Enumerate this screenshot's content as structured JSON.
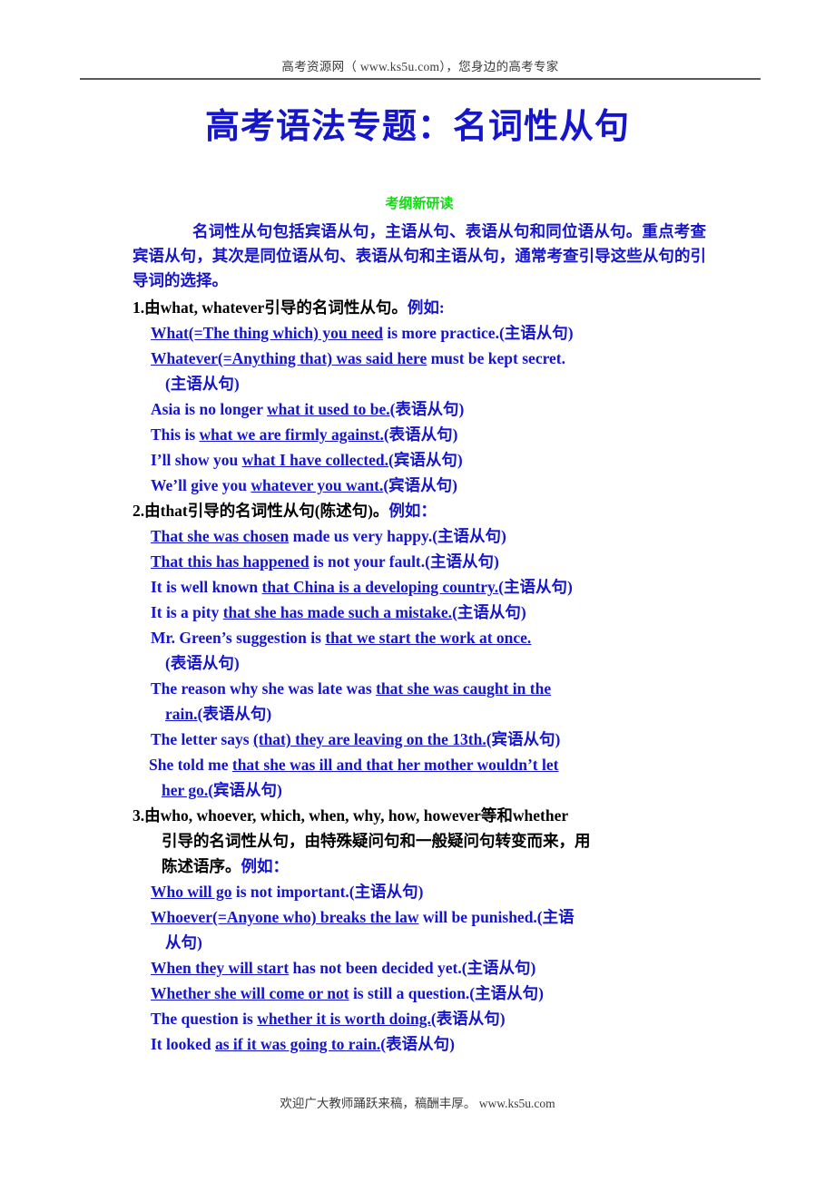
{
  "header": {
    "text": "高考资源网（ www.ks5u.com），您身边的高考专家"
  },
  "title": "高考语法专题：名词性从句",
  "section_heading": "考纲新研读",
  "intro": "名词性从句包括宾语从句，主语从句、表语从句和同位语从句。重点考查宾语从句，其次是同位语从句、表语从句和主语从句，通常考查引导这些从句的引导词的选择。",
  "rules": [
    {
      "number": "1.",
      "head_main": "由what, whatever引导的名词性从句。",
      "head_eg": "例如:",
      "examples": [
        {
          "lines": [
            {
              "parts": [
                {
                  "t": "What(=The thing which) you need",
                  "u": true
                },
                {
                  "t": " is more practice.(主语从句)",
                  "u": false
                }
              ]
            }
          ]
        },
        {
          "lines": [
            {
              "parts": [
                {
                  "t": "Whatever(=Anything that) was said here",
                  "u": true
                },
                {
                  "t": " must be kept secret.",
                  "u": false
                }
              ]
            },
            {
              "parts": [
                {
                  "t": "(主语从句)",
                  "u": false
                }
              ]
            }
          ]
        },
        {
          "lines": [
            {
              "parts": [
                {
                  "t": "Asia is no longer ",
                  "u": false
                },
                {
                  "t": "what it used to be.",
                  "u": true
                },
                {
                  "t": "(表语从句)",
                  "u": false
                }
              ]
            }
          ]
        },
        {
          "lines": [
            {
              "parts": [
                {
                  "t": "This is ",
                  "u": false
                },
                {
                  "t": "what we are firmly against.",
                  "u": true
                },
                {
                  "t": "(表语从句)",
                  "u": false
                }
              ]
            }
          ]
        },
        {
          "lines": [
            {
              "parts": [
                {
                  "t": "I’ll show you ",
                  "u": false
                },
                {
                  "t": "what I have collected.",
                  "u": true
                },
                {
                  "t": "(宾语从句)",
                  "u": false
                }
              ]
            }
          ]
        },
        {
          "lines": [
            {
              "parts": [
                {
                  "t": "We’ll give you ",
                  "u": false
                },
                {
                  "t": "whatever you want.",
                  "u": true
                },
                {
                  "t": "(宾语从句)",
                  "u": false
                }
              ]
            }
          ]
        }
      ]
    },
    {
      "number": "2.",
      "head_main": "由that引导的名词性从句(陈述句)。",
      "head_eg": "例如：",
      "examples": [
        {
          "lines": [
            {
              "parts": [
                {
                  "t": "That she was chosen",
                  "u": true
                },
                {
                  "t": " made us very happy.(主语从句)",
                  "u": false
                }
              ]
            }
          ]
        },
        {
          "lines": [
            {
              "parts": [
                {
                  "t": "That this has happened",
                  "u": true
                },
                {
                  "t": " is not your fault.(主语从句)",
                  "u": false
                }
              ]
            }
          ]
        },
        {
          "lines": [
            {
              "parts": [
                {
                  "t": "It is well known ",
                  "u": false
                },
                {
                  "t": "that China is a developing country.",
                  "u": true
                },
                {
                  "t": "(主语从句)",
                  "u": false
                }
              ]
            }
          ]
        },
        {
          "lines": [
            {
              "parts": [
                {
                  "t": "It is a pity ",
                  "u": false
                },
                {
                  "t": "that she has made such a mistake.",
                  "u": true
                },
                {
                  "t": "(主语从句)",
                  "u": false
                }
              ]
            }
          ]
        },
        {
          "lines": [
            {
              "parts": [
                {
                  "t": "Mr. Green’s suggestion is ",
                  "u": false
                },
                {
                  "t": "that we start the work at once.",
                  "u": true
                }
              ]
            },
            {
              "parts": [
                {
                  "t": "(表语从句)",
                  "u": false
                }
              ]
            }
          ]
        },
        {
          "lines": [
            {
              "parts": [
                {
                  "t": "The reason why she was late was ",
                  "u": false
                },
                {
                  "t": "that she was caught in the ",
                  "u": true
                }
              ]
            },
            {
              "parts": [
                {
                  "t": "rain.",
                  "u": true
                },
                {
                  "t": "(表语从句)",
                  "u": false
                }
              ]
            }
          ]
        },
        {
          "lines": [
            {
              "parts": [
                {
                  "t": "The letter says ",
                  "u": false
                },
                {
                  "t": "(that) they are leaving on the 13th.",
                  "u": true
                },
                {
                  "t": "(宾语从句)",
                  "u": false
                }
              ]
            }
          ]
        },
        {
          "lines": [
            {
              "parts": [
                {
                  "t": "She told me ",
                  "u": false
                },
                {
                  "t": "that she was ill and that her mother wouldn’t let ",
                  "u": true
                }
              ]
            },
            {
              "parts": [
                {
                  "t": "her go.",
                  "u": true
                },
                {
                  "t": "(宾语从句)",
                  "u": false
                }
              ]
            }
          ]
        }
      ]
    },
    {
      "number": "3.",
      "head_main": "由who, whoever, which, when, why, how, however等和whether",
      "head_cont1": "引导的名词性从句，由特殊疑问句和一般疑问句转变而来，用",
      "head_cont2": "陈述语序。",
      "head_eg": "例如：",
      "examples": [
        {
          "lines": [
            {
              "parts": [
                {
                  "t": "Who will go",
                  "u": true
                },
                {
                  "t": " is not important.(主语从句)",
                  "u": false
                }
              ]
            }
          ]
        },
        {
          "lines": [
            {
              "parts": [
                {
                  "t": "Whoever(=Anyone who) breaks the law",
                  "u": true
                },
                {
                  "t": " will be punished.(主语",
                  "u": false
                }
              ]
            },
            {
              "parts": [
                {
                  "t": "从句)",
                  "u": false
                }
              ]
            }
          ]
        },
        {
          "lines": [
            {
              "parts": [
                {
                  "t": "When they will start",
                  "u": true
                },
                {
                  "t": " has not been decided yet.(主语从句)",
                  "u": false
                }
              ]
            }
          ]
        },
        {
          "lines": [
            {
              "parts": [
                {
                  "t": "Whether she will come or not",
                  "u": true
                },
                {
                  "t": " is still a question.(主语从句)",
                  "u": false
                }
              ]
            }
          ]
        },
        {
          "lines": [
            {
              "parts": [
                {
                  "t": "The question is ",
                  "u": false
                },
                {
                  "t": "whether it is worth doing.",
                  "u": true
                },
                {
                  "t": "(表语从句)",
                  "u": false
                }
              ]
            }
          ]
        },
        {
          "lines": [
            {
              "parts": [
                {
                  "t": "It looked ",
                  "u": false
                },
                {
                  "t": "as if it was going to rain.",
                  "u": true
                },
                {
                  "t": "(表语从句)",
                  "u": false
                }
              ]
            }
          ]
        }
      ]
    }
  ],
  "footer": {
    "text": "欢迎广大教师踊跃来稿，稿酬丰厚。 www.ks5u.com"
  },
  "colors": {
    "title_blue": "#1515CC",
    "heading_green": "#17D817",
    "body_black": "#000000",
    "rule_gray": "#595959"
  }
}
